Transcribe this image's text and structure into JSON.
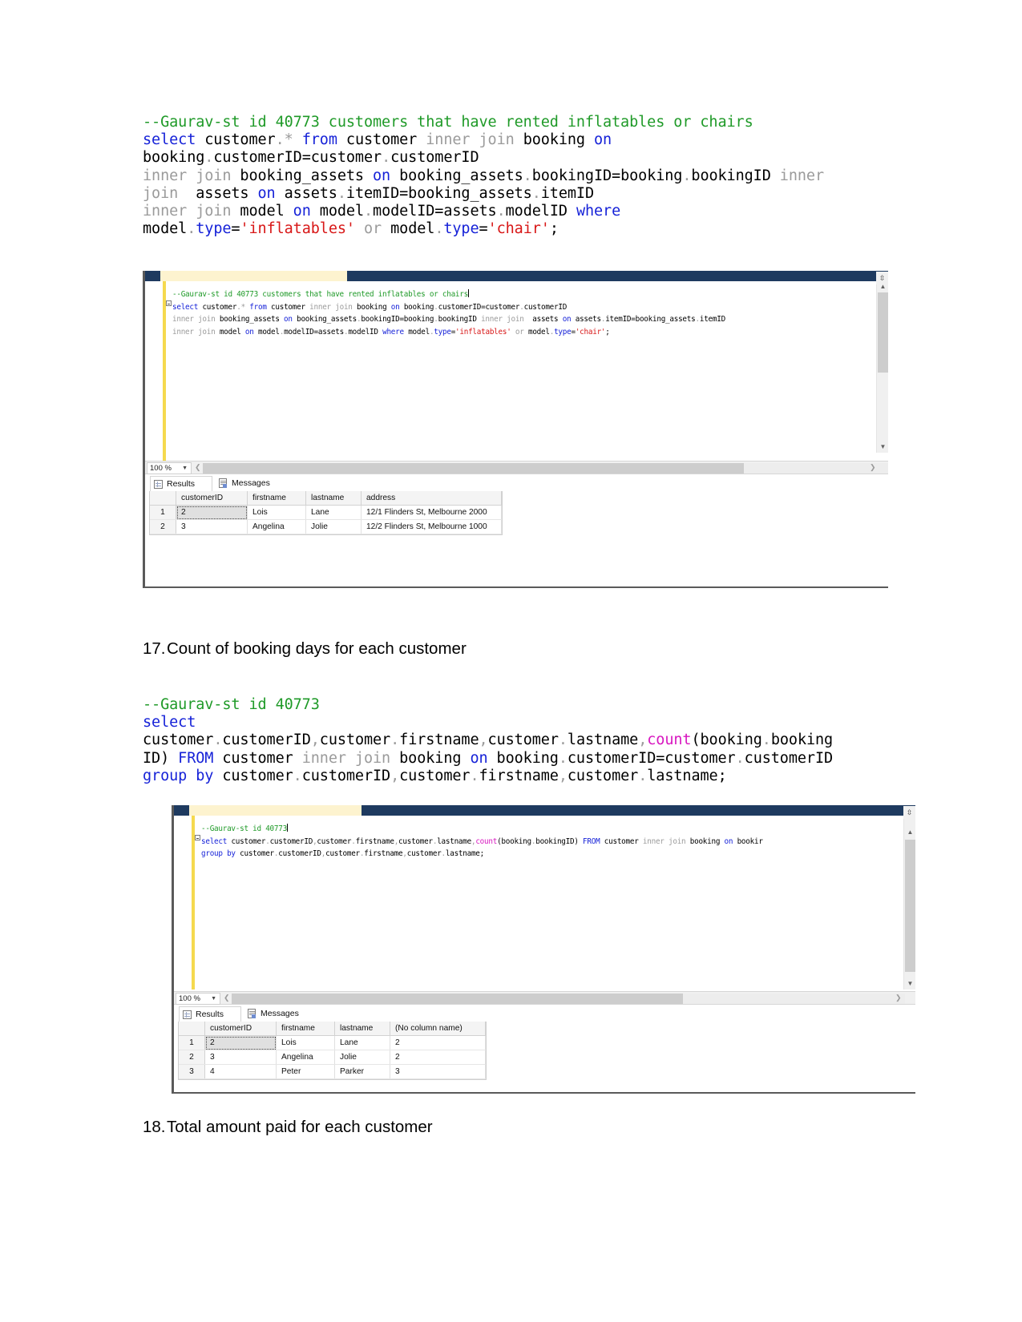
{
  "document": {
    "block1": {
      "lines": [
        [
          {
            "t": "--Gaurav-st id 40773 customers that have rented inflatables or chairs",
            "c": "comment"
          }
        ],
        [
          {
            "t": "select",
            "c": "blue"
          },
          {
            "t": " customer",
            "c": "black"
          },
          {
            "t": ".",
            "c": "gray"
          },
          {
            "t": "*",
            "c": "gray"
          },
          {
            "t": " ",
            "c": "black"
          },
          {
            "t": "from",
            "c": "blue"
          },
          {
            "t": " customer ",
            "c": "black"
          },
          {
            "t": "inner join",
            "c": "gray"
          },
          {
            "t": " booking ",
            "c": "black"
          },
          {
            "t": "on",
            "c": "blue"
          }
        ],
        [
          {
            "t": "booking",
            "c": "black"
          },
          {
            "t": ".",
            "c": "gray"
          },
          {
            "t": "customerID=customer",
            "c": "black"
          },
          {
            "t": ".",
            "c": "gray"
          },
          {
            "t": "customerID",
            "c": "black"
          }
        ],
        [
          {
            "t": "inner join",
            "c": "gray"
          },
          {
            "t": " booking_assets ",
            "c": "black"
          },
          {
            "t": "on",
            "c": "blue"
          },
          {
            "t": " booking_assets",
            "c": "black"
          },
          {
            "t": ".",
            "c": "gray"
          },
          {
            "t": "bookingID=booking",
            "c": "black"
          },
          {
            "t": ".",
            "c": "gray"
          },
          {
            "t": "bookingID ",
            "c": "black"
          },
          {
            "t": "inner",
            "c": "gray"
          }
        ],
        [
          {
            "t": "join",
            "c": "gray"
          },
          {
            "t": "  assets ",
            "c": "black"
          },
          {
            "t": "on",
            "c": "blue"
          },
          {
            "t": " assets",
            "c": "black"
          },
          {
            "t": ".",
            "c": "gray"
          },
          {
            "t": "itemID=booking_assets",
            "c": "black"
          },
          {
            "t": ".",
            "c": "gray"
          },
          {
            "t": "itemID",
            "c": "black"
          }
        ],
        [
          {
            "t": "inner join",
            "c": "gray"
          },
          {
            "t": " model ",
            "c": "black"
          },
          {
            "t": "on",
            "c": "blue"
          },
          {
            "t": " model",
            "c": "black"
          },
          {
            "t": ".",
            "c": "gray"
          },
          {
            "t": "modelID=assets",
            "c": "black"
          },
          {
            "t": ".",
            "c": "gray"
          },
          {
            "t": "modelID ",
            "c": "black"
          },
          {
            "t": "where",
            "c": "blue"
          }
        ],
        [
          {
            "t": "model",
            "c": "black"
          },
          {
            "t": ".",
            "c": "gray"
          },
          {
            "t": "type",
            "c": "blue"
          },
          {
            "t": "=",
            "c": "black"
          },
          {
            "t": "'inflatables'",
            "c": "red"
          },
          {
            "t": " ",
            "c": "black"
          },
          {
            "t": "or",
            "c": "gray"
          },
          {
            "t": " model",
            "c": "black"
          },
          {
            "t": ".",
            "c": "gray"
          },
          {
            "t": "type",
            "c": "blue"
          },
          {
            "t": "=",
            "c": "black"
          },
          {
            "t": "'chair'",
            "c": "red"
          },
          {
            "t": ";",
            "c": "black"
          }
        ]
      ]
    },
    "heading17": {
      "number": "17.",
      "text": "Count of booking days for each customer"
    },
    "block2": {
      "lines": [
        [
          {
            "t": "--Gaurav-st id 40773",
            "c": "comment"
          }
        ],
        [
          {
            "t": "select",
            "c": "blue"
          }
        ],
        [
          {
            "t": "customer",
            "c": "black"
          },
          {
            "t": ".",
            "c": "gray"
          },
          {
            "t": "customerID",
            "c": "black"
          },
          {
            "t": ",",
            "c": "gray"
          },
          {
            "t": "customer",
            "c": "black"
          },
          {
            "t": ".",
            "c": "gray"
          },
          {
            "t": "firstname",
            "c": "black"
          },
          {
            "t": ",",
            "c": "gray"
          },
          {
            "t": "customer",
            "c": "black"
          },
          {
            "t": ".",
            "c": "gray"
          },
          {
            "t": "lastname",
            "c": "black"
          },
          {
            "t": ",",
            "c": "gray"
          },
          {
            "t": "count",
            "c": "magenta"
          },
          {
            "t": "(booking",
            "c": "black"
          },
          {
            "t": ".",
            "c": "gray"
          },
          {
            "t": "booking",
            "c": "black"
          }
        ],
        [
          {
            "t": "ID) ",
            "c": "black"
          },
          {
            "t": "FROM",
            "c": "blue"
          },
          {
            "t": " customer ",
            "c": "black"
          },
          {
            "t": "inner join",
            "c": "gray"
          },
          {
            "t": " booking ",
            "c": "black"
          },
          {
            "t": "on",
            "c": "blue"
          },
          {
            "t": " booking",
            "c": "black"
          },
          {
            "t": ".",
            "c": "gray"
          },
          {
            "t": "customerID=customer",
            "c": "black"
          },
          {
            "t": ".",
            "c": "gray"
          },
          {
            "t": "customerID",
            "c": "black"
          }
        ],
        [
          {
            "t": "group by",
            "c": "blue"
          },
          {
            "t": " customer",
            "c": "black"
          },
          {
            "t": ".",
            "c": "gray"
          },
          {
            "t": "customerID",
            "c": "black"
          },
          {
            "t": ",",
            "c": "gray"
          },
          {
            "t": "customer",
            "c": "black"
          },
          {
            "t": ".",
            "c": "gray"
          },
          {
            "t": "firstname",
            "c": "black"
          },
          {
            "t": ",",
            "c": "gray"
          },
          {
            "t": "customer",
            "c": "black"
          },
          {
            "t": ".",
            "c": "gray"
          },
          {
            "t": "lastname",
            "c": "black"
          },
          {
            "t": ";",
            "c": "black"
          }
        ]
      ]
    },
    "heading18": {
      "number": "18.",
      "text": "Total amount paid for each customer"
    }
  },
  "screenshot1": {
    "editor": {
      "lines": [
        [
          {
            "t": "--Gaurav-st id 40773 customers that have rented inflatables or chairs",
            "c": "comment"
          },
          {
            "t": "|",
            "c": "caret"
          }
        ],
        [
          {
            "t": "select",
            "c": "blue"
          },
          {
            "t": " customer",
            "c": "black"
          },
          {
            "t": ".",
            "c": "gray"
          },
          {
            "t": "*",
            "c": "gray"
          },
          {
            "t": " ",
            "c": "black"
          },
          {
            "t": "from",
            "c": "blue"
          },
          {
            "t": " customer ",
            "c": "black"
          },
          {
            "t": "inner join",
            "c": "gray"
          },
          {
            "t": " booking ",
            "c": "black"
          },
          {
            "t": "on",
            "c": "blue"
          },
          {
            "t": " booking",
            "c": "black"
          },
          {
            "t": ".",
            "c": "gray"
          },
          {
            "t": "customerID=customer",
            "c": "black"
          },
          {
            "t": ".",
            "c": "gray"
          },
          {
            "t": "customerID",
            "c": "black"
          }
        ],
        [
          {
            "t": "inner join",
            "c": "gray"
          },
          {
            "t": " booking_assets ",
            "c": "black"
          },
          {
            "t": "on",
            "c": "blue"
          },
          {
            "t": " booking_assets",
            "c": "black"
          },
          {
            "t": ".",
            "c": "gray"
          },
          {
            "t": "bookingID=booking",
            "c": "black"
          },
          {
            "t": ".",
            "c": "gray"
          },
          {
            "t": "bookingID ",
            "c": "black"
          },
          {
            "t": "inner join",
            "c": "gray"
          },
          {
            "t": "  assets ",
            "c": "black"
          },
          {
            "t": "on",
            "c": "blue"
          },
          {
            "t": " assets",
            "c": "black"
          },
          {
            "t": ".",
            "c": "gray"
          },
          {
            "t": "itemID=booking_assets",
            "c": "black"
          },
          {
            "t": ".",
            "c": "gray"
          },
          {
            "t": "itemID",
            "c": "black"
          }
        ],
        [
          {
            "t": "inner join",
            "c": "gray"
          },
          {
            "t": " model ",
            "c": "black"
          },
          {
            "t": "on",
            "c": "blue"
          },
          {
            "t": " model",
            "c": "black"
          },
          {
            "t": ".",
            "c": "gray"
          },
          {
            "t": "modelID=assets",
            "c": "black"
          },
          {
            "t": ".",
            "c": "gray"
          },
          {
            "t": "modelID ",
            "c": "black"
          },
          {
            "t": "where",
            "c": "blue"
          },
          {
            "t": " model",
            "c": "black"
          },
          {
            "t": ".",
            "c": "gray"
          },
          {
            "t": "type",
            "c": "blue"
          },
          {
            "t": "=",
            "c": "black"
          },
          {
            "t": "'inflatables'",
            "c": "red"
          },
          {
            "t": " ",
            "c": "black"
          },
          {
            "t": "or",
            "c": "gray"
          },
          {
            "t": " model",
            "c": "black"
          },
          {
            "t": ".",
            "c": "gray"
          },
          {
            "t": "type",
            "c": "blue"
          },
          {
            "t": "=",
            "c": "black"
          },
          {
            "t": "'chair'",
            "c": "red"
          },
          {
            "t": ";",
            "c": "black"
          }
        ]
      ]
    },
    "zoom_level": "100 %",
    "tabs": {
      "results": "Results",
      "messages": "Messages"
    },
    "grid": {
      "columns": [
        "customerID",
        "firstname",
        "lastname",
        "address"
      ],
      "rows": [
        {
          "n": "1",
          "cells": [
            "2",
            "Lois",
            "Lane",
            "12/1 Flinders St, Melbourne 2000"
          ]
        },
        {
          "n": "2",
          "cells": [
            "3",
            "Angelina",
            "Jolie",
            "12/2 Flinders St, Melbourne 1000"
          ]
        }
      ]
    }
  },
  "screenshot2": {
    "editor": {
      "lines": [
        [
          {
            "t": "--Gaurav-st id 40773",
            "c": "comment"
          },
          {
            "t": "|",
            "c": "caret"
          }
        ],
        [
          {
            "t": "select",
            "c": "blue"
          },
          {
            "t": " customer",
            "c": "black"
          },
          {
            "t": ".",
            "c": "gray"
          },
          {
            "t": "customerID",
            "c": "black"
          },
          {
            "t": ",",
            "c": "gray"
          },
          {
            "t": "customer",
            "c": "black"
          },
          {
            "t": ".",
            "c": "gray"
          },
          {
            "t": "firstname",
            "c": "black"
          },
          {
            "t": ",",
            "c": "gray"
          },
          {
            "t": "customer",
            "c": "black"
          },
          {
            "t": ".",
            "c": "gray"
          },
          {
            "t": "lastname",
            "c": "black"
          },
          {
            "t": ",",
            "c": "gray"
          },
          {
            "t": "count",
            "c": "magenta"
          },
          {
            "t": "(booking",
            "c": "black"
          },
          {
            "t": ".",
            "c": "gray"
          },
          {
            "t": "bookingID) ",
            "c": "black"
          },
          {
            "t": "FROM",
            "c": "blue"
          },
          {
            "t": " customer ",
            "c": "black"
          },
          {
            "t": "inner join",
            "c": "gray"
          },
          {
            "t": " booking ",
            "c": "black"
          },
          {
            "t": "on",
            "c": "blue"
          },
          {
            "t": " bookir",
            "c": "black"
          }
        ],
        [
          {
            "t": "group by",
            "c": "blue"
          },
          {
            "t": " customer",
            "c": "black"
          },
          {
            "t": ".",
            "c": "gray"
          },
          {
            "t": "customerID",
            "c": "black"
          },
          {
            "t": ",",
            "c": "gray"
          },
          {
            "t": "customer",
            "c": "black"
          },
          {
            "t": ".",
            "c": "gray"
          },
          {
            "t": "firstname",
            "c": "black"
          },
          {
            "t": ",",
            "c": "gray"
          },
          {
            "t": "customer",
            "c": "black"
          },
          {
            "t": ".",
            "c": "gray"
          },
          {
            "t": "lastname",
            "c": "black"
          },
          {
            "t": ";",
            "c": "black"
          }
        ]
      ]
    },
    "zoom_level": "100 %",
    "tabs": {
      "results": "Results",
      "messages": "Messages"
    },
    "grid": {
      "columns": [
        "customerID",
        "firstname",
        "lastname",
        "(No column name)"
      ],
      "rows": [
        {
          "n": "1",
          "cells": [
            "2",
            "Lois",
            "Lane",
            "2"
          ]
        },
        {
          "n": "2",
          "cells": [
            "3",
            "Angelina",
            "Jolie",
            "2"
          ]
        },
        {
          "n": "3",
          "cells": [
            "4",
            "Peter",
            "Parker",
            "3"
          ]
        }
      ]
    }
  }
}
